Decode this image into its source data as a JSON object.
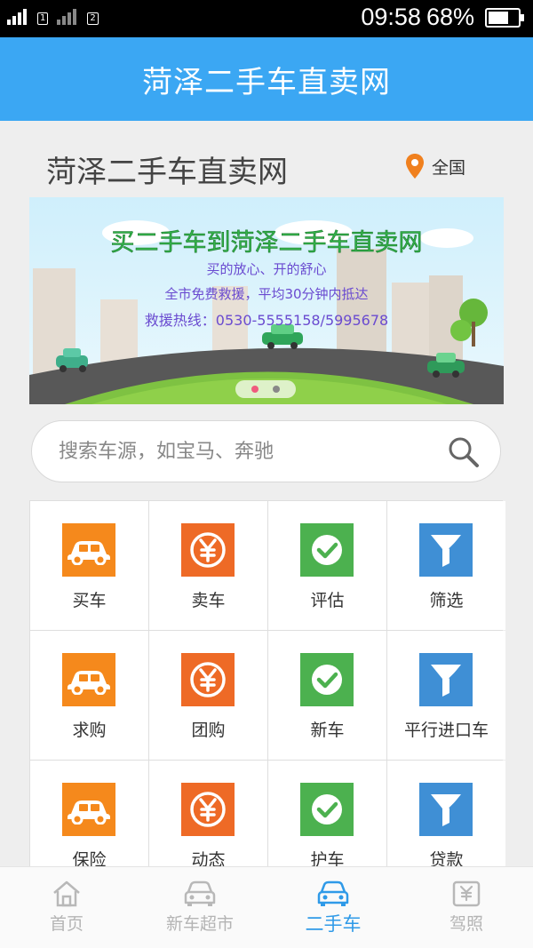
{
  "status_bar": {
    "sim1": "1",
    "sim2": "2",
    "time": "09:58",
    "battery": "68%",
    "battery_level": 0.68
  },
  "app_header": {
    "title": "菏泽二手车直卖网"
  },
  "title_row": {
    "title": "菏泽二手车直卖网",
    "location": "全国"
  },
  "banner": {
    "headline": "买二手车到菏泽二手车直卖网",
    "line1": "买的放心、开的舒心",
    "line2": "全市免费救援，平均30分钟内抵达",
    "line3": "救援热线：0530-5555158/5995678",
    "slide_count": 2,
    "active_slide": 0
  },
  "search": {
    "placeholder": "搜索车源，如宝马、奔驰"
  },
  "grid": {
    "items": [
      {
        "label": "买车",
        "icon": "car-icon",
        "color": "#f5891c"
      },
      {
        "label": "卖车",
        "icon": "yuan-icon",
        "color": "#ee6a26"
      },
      {
        "label": "评估",
        "icon": "check-icon",
        "color": "#4cb14f"
      },
      {
        "label": "筛选",
        "icon": "filter-icon",
        "color": "#3f8fd5"
      },
      {
        "label": "求购",
        "icon": "car-icon",
        "color": "#f5891c"
      },
      {
        "label": "团购",
        "icon": "yuan-icon",
        "color": "#ee6a26"
      },
      {
        "label": "新车",
        "icon": "check-icon",
        "color": "#4cb14f"
      },
      {
        "label": "平行进口车",
        "icon": "filter-icon",
        "color": "#3f8fd5"
      },
      {
        "label": "保险",
        "icon": "car-icon",
        "color": "#f5891c"
      },
      {
        "label": "动态",
        "icon": "yuan-icon",
        "color": "#ee6a26"
      },
      {
        "label": "护车",
        "icon": "check-icon",
        "color": "#4cb14f"
      },
      {
        "label": "贷款",
        "icon": "filter-icon",
        "color": "#3f8fd5"
      }
    ]
  },
  "bottom_nav": {
    "items": [
      {
        "label": "首页",
        "icon": "home-icon"
      },
      {
        "label": "新车超市",
        "icon": "car-front-icon"
      },
      {
        "label": "二手车",
        "icon": "car-front-icon"
      },
      {
        "label": "驾照",
        "icon": "license-icon"
      }
    ],
    "active_index": 2
  },
  "colors": {
    "header": "#3ba7f3",
    "accent": "#2f9ae8",
    "location_pin": "#f0801e"
  }
}
